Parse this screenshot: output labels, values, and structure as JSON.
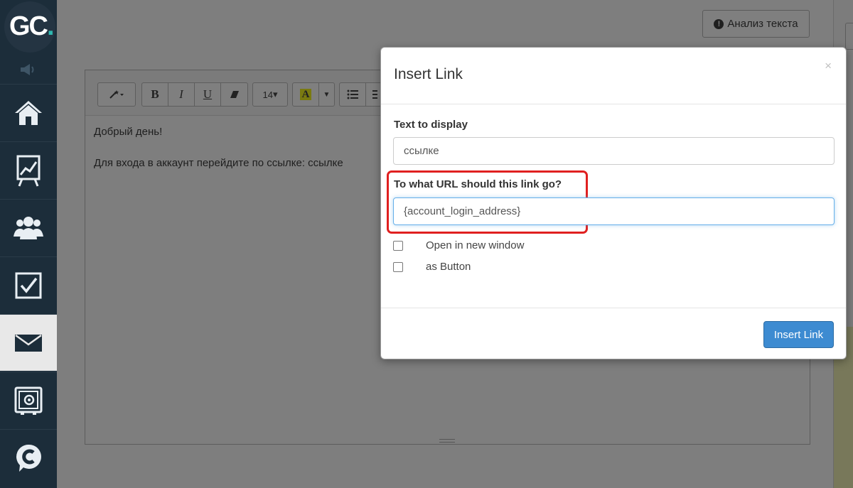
{
  "sidebar": {
    "logo": {
      "letters": "GC",
      "dot": "."
    },
    "items": [
      {
        "icon": "home-icon"
      },
      {
        "icon": "chart-icon"
      },
      {
        "icon": "users-icon"
      },
      {
        "icon": "checkbox-icon"
      },
      {
        "icon": "mail-icon",
        "active": true
      },
      {
        "icon": "safe-icon"
      },
      {
        "icon": "chat-c-icon"
      }
    ]
  },
  "header": {
    "analyze_button": "Анализ текста",
    "analyze_icon_glyph": "!"
  },
  "editor": {
    "toolbar": {
      "magic_label": "",
      "bold": "B",
      "italic": "I",
      "underline": "U",
      "font_size": "14",
      "color_letter": "A"
    },
    "lines": [
      "Добрый день!",
      "Для входа в аккаунт перейдите по ссылке: ссылке"
    ]
  },
  "modal": {
    "title": "Insert Link",
    "close_glyph": "×",
    "text_label": "Text to display",
    "text_value": "ссылке",
    "url_label": "To what URL should this link go?",
    "url_value": "{account_login_address}",
    "new_window_label": "Open in new window",
    "as_button_label": "as Button",
    "new_window_checked": false,
    "as_button_checked": false,
    "submit_label": "Insert Link"
  },
  "colors": {
    "accent": "#3d8bd1",
    "highlight": "#e02020",
    "sidebar": "#1c2d3a",
    "logo_dot": "#2fb8b0"
  }
}
